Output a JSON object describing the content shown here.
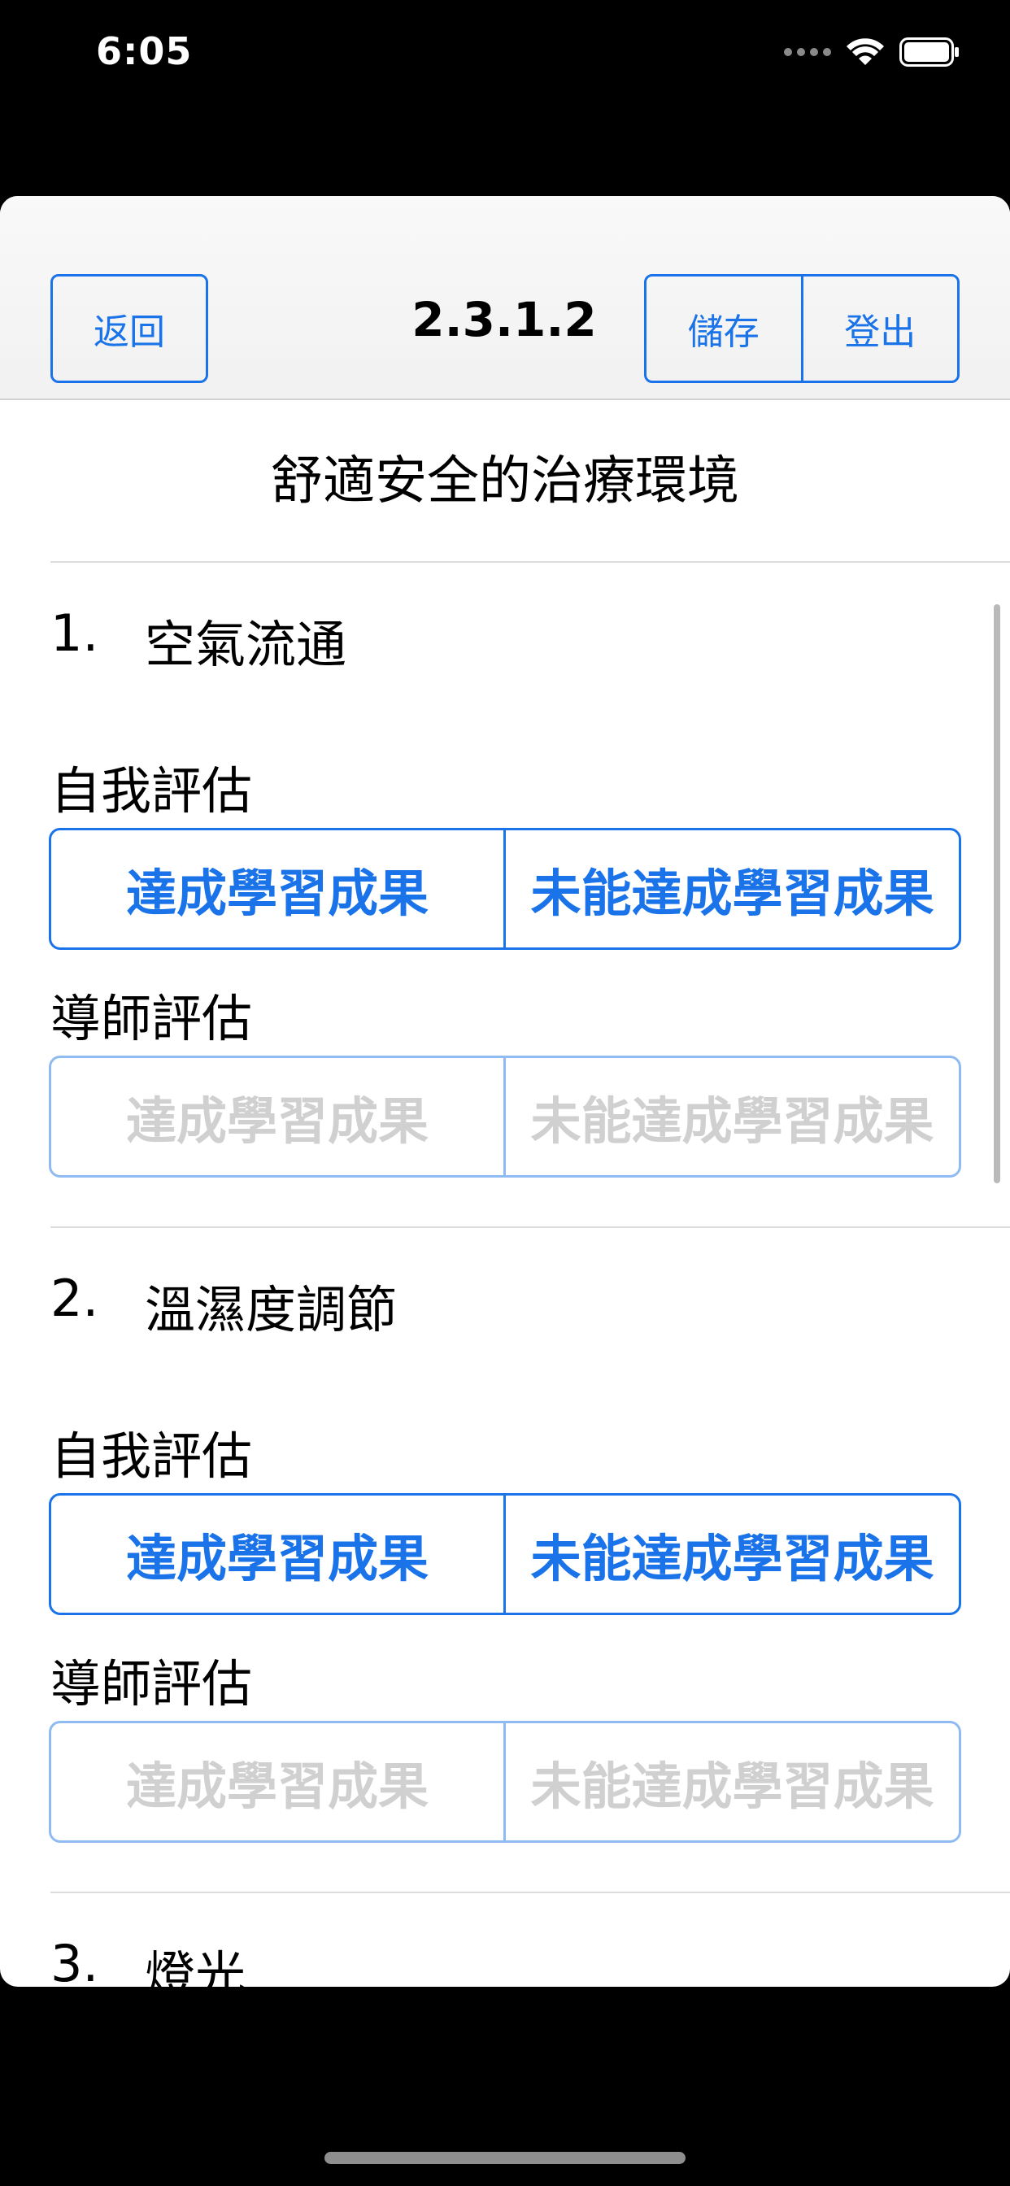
{
  "status_bar": {
    "time": "6:05",
    "icons": [
      "signal-dots-icon",
      "wifi-icon",
      "battery-icon"
    ]
  },
  "nav": {
    "back_label": "返回",
    "title": "2.3.1.2",
    "save_label": "儲存",
    "logout_label": "登出"
  },
  "content": {
    "section_heading": "舒適安全的治療環境",
    "items": [
      {
        "number": "1.",
        "title": "空氣流通",
        "self_label": "自我評估",
        "tutor_label": "導師評估",
        "achieved": "達成學習成果",
        "not_achieved": "未能達成學習成果"
      },
      {
        "number": "2.",
        "title": "溫濕度調節",
        "self_label": "自我評估",
        "tutor_label": "導師評估",
        "achieved": "達成學習成果",
        "not_achieved": "未能達成學習成果"
      },
      {
        "number": "3.",
        "title": "燈光"
      }
    ]
  },
  "colors": {
    "accent": "#1a73e8",
    "disabled_text": "#d0d0d0",
    "disabled_border": "#8fbaf2"
  }
}
